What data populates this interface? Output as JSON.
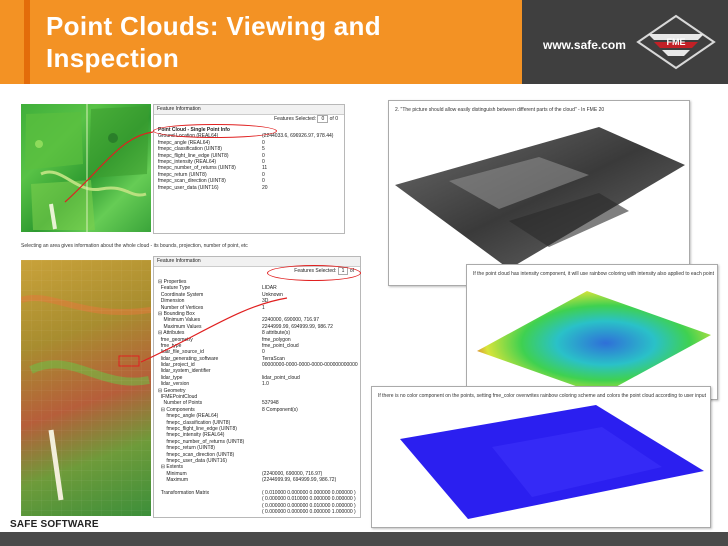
{
  "slide": {
    "title_line1": "Point Clouds: Viewing and",
    "title_line2": "Inspection",
    "website": "www.safe.com",
    "footer": "SAFE SOFTWARE"
  },
  "top_panel": {
    "window_title": "Feature Information",
    "features_selected_label": "Features Selected:",
    "features_selected_value": "0",
    "of_label": "of 0",
    "section": "Point Cloud - Single Point Info",
    "rows": [
      {
        "k": "Ground Location (REAL64)",
        "v": "(2244033.6, 696926.97, 978.44)"
      },
      {
        "k": "fmepc_angle (REAL64)",
        "v": "0"
      },
      {
        "k": "fmepc_classification (UINT8)",
        "v": "5"
      },
      {
        "k": "fmepc_flight_line_edge (UINT8)",
        "v": "0"
      },
      {
        "k": "fmepc_intensity (REAL64)",
        "v": "0"
      },
      {
        "k": "fmepc_number_of_returns (UINT8)",
        "v": "11"
      },
      {
        "k": "fmepc_return (UINT8)",
        "v": "0"
      },
      {
        "k": "fmepc_scan_direction (UINT8)",
        "v": "0"
      },
      {
        "k": "fmepc_user_data (UINT16)",
        "v": "20"
      }
    ]
  },
  "middle_caption": "Selecting an area gives information about the whole cloud - its bounds, projection, number of point, etc",
  "bottom_panel": {
    "window_title": "Feature Information",
    "features_selected_label": "Features Selected:",
    "features_selected_value": "1",
    "of_label": "of",
    "rows": [
      {
        "k": "⊟ Properties",
        "v": ""
      },
      {
        "k": "  Feature Type",
        "v": "LIDAR"
      },
      {
        "k": "  Coordinate System",
        "v": "Unknown"
      },
      {
        "k": "  Dimension",
        "v": "3D"
      },
      {
        "k": "  Number of Vertices",
        "v": "1"
      },
      {
        "k": "⊟ Bounding Box",
        "v": ""
      },
      {
        "k": "    Minimum Values",
        "v": "2240000, 690000, 716.97"
      },
      {
        "k": "    Maximum Values",
        "v": "2244999.99, 694999.99, 986.72"
      },
      {
        "k": "⊟ Attributes",
        "v": "8 attribute(s)"
      },
      {
        "k": "  fme_geometry",
        "v": "fme_polygon"
      },
      {
        "k": "  fme_type",
        "v": "fme_point_cloud"
      },
      {
        "k": "  lidar_file_source_id",
        "v": "0"
      },
      {
        "k": "  lidar_generating_software",
        "v": "TerraScan"
      },
      {
        "k": "  lidar_project_id",
        "v": "00000000-0000-0000-0000-000000000000"
      },
      {
        "k": "  lidar_system_identifier",
        "v": ""
      },
      {
        "k": "  lidar_type",
        "v": "lidar_point_cloud"
      },
      {
        "k": "  lidar_version",
        "v": "1.0"
      },
      {
        "k": "⊟ Geometry",
        "v": ""
      },
      {
        "k": "  IFMEPointCloud",
        "v": ""
      },
      {
        "k": "    Number of Points",
        "v": "537948"
      },
      {
        "k": "  ⊟ Components",
        "v": "8 Component(s)"
      },
      {
        "k": "      fmepc_angle (REAL64)",
        "v": ""
      },
      {
        "k": "      fmepc_classification (UINT8)",
        "v": ""
      },
      {
        "k": "      fmepc_flight_line_edge (UINT8)",
        "v": ""
      },
      {
        "k": "      fmepc_intensity (REAL64)",
        "v": ""
      },
      {
        "k": "      fmepc_number_of_returns (UINT8)",
        "v": ""
      },
      {
        "k": "      fmepc_return (UINT8)",
        "v": ""
      },
      {
        "k": "      fmepc_scan_direction (UINT8)",
        "v": ""
      },
      {
        "k": "      fmepc_user_data (UINT16)",
        "v": ""
      },
      {
        "k": "  ⊟ Extents",
        "v": ""
      },
      {
        "k": "      Minimum",
        "v": "(2240000, 690000, 716.97)"
      },
      {
        "k": "      Maximum",
        "v": "(2244999.99, 694999.99, 986.72)"
      },
      {
        "k": "",
        "v": ""
      },
      {
        "k": "  Transformation Matrix",
        "v": "( 0.010000 0.000000 0.000000 0.000000 )"
      }
    ],
    "matrix_extra": [
      "( 0.000000 0.010000 0.000000 0.000000 )",
      "( 0.000000 0.000000 0.010000 0.000000 )",
      "( 0.000000 0.000000 0.000000 1.000000 )"
    ]
  },
  "shots": {
    "one_caption": "2. \"The picture should allow easily distinguish between different parts of the cloud\" - In FME 20",
    "two_caption": "If the point cloud has intensity component, it will use rainbow coloring with intensity also applied to each point",
    "three_caption": "If there is no color component on the points, setting fme_color overwrites rainbow coloring scheme and colors the point cloud according to user input"
  },
  "colors": {
    "header_orange": "#f39224",
    "brand_dark": "#3f3f3f",
    "highlight_red": "#e02020"
  }
}
